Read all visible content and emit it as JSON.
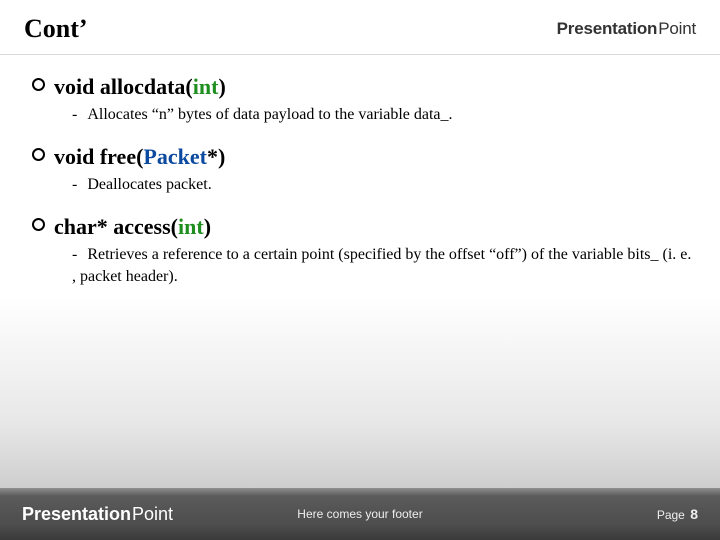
{
  "header": {
    "title": "Cont’",
    "brand_strong": "Presentation",
    "brand_light": "Point"
  },
  "items": [
    {
      "sig": {
        "kw": "void",
        "name": " allocdata(",
        "type": "int",
        "tail": ")"
      },
      "desc_prefix": "-  ",
      "desc": "Allocates “n” bytes of data payload to the variable data_."
    },
    {
      "sig": {
        "kw": "void",
        "name": " free(",
        "link": "Packet",
        "tail": "*)"
      },
      "desc_prefix": "- ",
      "desc": "Deallocates packet."
    },
    {
      "sig": {
        "kw": "char",
        "mid": "* access(",
        "type": "int",
        "tail": ")"
      },
      "desc_prefix": "- ",
      "desc": "Retrieves a reference to a certain point (specified by the offset “off”) of the variable bits_ (i. e. , packet header)."
    }
  ],
  "footer": {
    "brand_strong": "Presentation",
    "brand_light": "Point",
    "center": "Here comes your footer",
    "page_label": "Page",
    "page_number": "8"
  }
}
